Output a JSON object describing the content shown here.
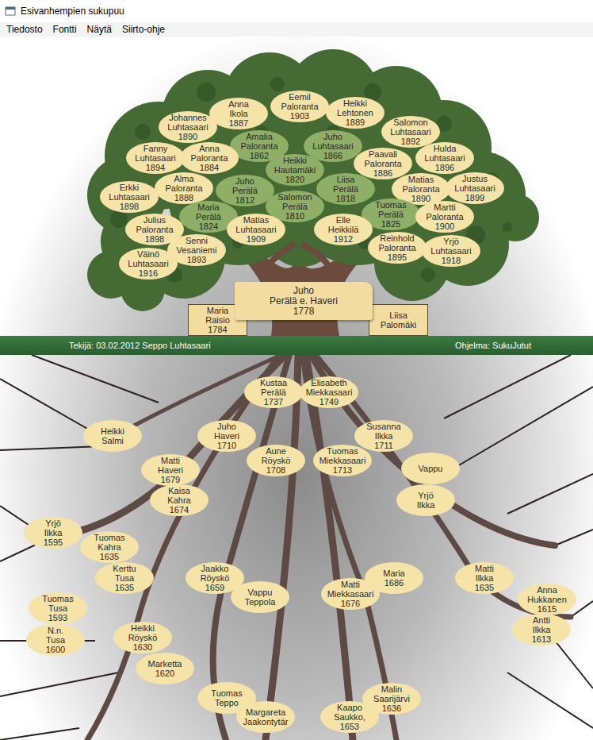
{
  "window": {
    "title": "Esivanhempien sukupuu"
  },
  "menu": [
    "Tiedosto",
    "Fontti",
    "Näytä",
    "Siirto-ohje"
  ],
  "descendants": [
    {
      "lines": [
        "Anna",
        "Ikola",
        "1887"
      ],
      "color": "#f6e3a8"
    },
    {
      "lines": [
        "Eemil",
        "Paloranta",
        "1903"
      ],
      "color": "#f6e3a8"
    },
    {
      "lines": [
        "Heikki",
        "Lehtonen",
        "1889"
      ],
      "color": "#f6e3a8"
    },
    {
      "lines": [
        "Johannes",
        "Luhtasaari",
        "1890"
      ],
      "color": "#f6e3a8"
    },
    {
      "lines": [
        "Salomon",
        "Luhtasaari",
        "1892"
      ],
      "color": "#f6e3a8"
    },
    {
      "lines": [
        "Amalia",
        "Paloranta",
        "1862"
      ],
      "color": "#8fae66"
    },
    {
      "lines": [
        "Juho",
        "Luhtasaari",
        "1866"
      ],
      "color": "#8fae66"
    },
    {
      "lines": [
        "Fanny",
        "Luhtasaari",
        "1894"
      ],
      "color": "#f6e3a8"
    },
    {
      "lines": [
        "Anna",
        "Paloranta",
        "1884"
      ],
      "color": "#f6e3a8"
    },
    {
      "lines": [
        "Hulda",
        "Luhtasaari",
        "1896"
      ],
      "color": "#f6e3a8"
    },
    {
      "lines": [
        "Paavali",
        "Paloranta",
        "1886"
      ],
      "color": "#f6e3a8"
    },
    {
      "lines": [
        "Heikki",
        "Hautamäki",
        "1820"
      ],
      "color": "#8fae66"
    },
    {
      "lines": [
        "Erkki",
        "Luhtasaari",
        "1898"
      ],
      "color": "#f6e3a8"
    },
    {
      "lines": [
        "Alma",
        "Paloranta",
        "1888"
      ],
      "color": "#f6e3a8"
    },
    {
      "lines": [
        "Juho",
        "Perälä",
        "1812"
      ],
      "color": "#8fae66"
    },
    {
      "lines": [
        "Liisa",
        "Perälä",
        "1818"
      ],
      "color": "#8fae66"
    },
    {
      "lines": [
        "Matias",
        "Paloranta",
        "1890"
      ],
      "color": "#f6e3a8"
    },
    {
      "lines": [
        "Justus",
        "Luhtasaari",
        "1899"
      ],
      "color": "#f6e3a8"
    },
    {
      "lines": [
        "Salomon",
        "Perälä",
        "1810"
      ],
      "color": "#8fae66"
    },
    {
      "lines": [
        "Maria",
        "Perälä",
        "1824"
      ],
      "color": "#8fae66"
    },
    {
      "lines": [
        "Tuomas",
        "Perälä",
        "1825"
      ],
      "color": "#8fae66"
    },
    {
      "lines": [
        "Martti",
        "Paloranta",
        "1900"
      ],
      "color": "#f6e3a8"
    },
    {
      "lines": [
        "Julius",
        "Paloranta",
        "1898"
      ],
      "color": "#f6e3a8"
    },
    {
      "lines": [
        "Matias",
        "Luhtasaari",
        "1909"
      ],
      "color": "#f6e3a8"
    },
    {
      "lines": [
        "Elle",
        "Heikkilä",
        "1912"
      ],
      "color": "#f6e3a8"
    },
    {
      "lines": [
        "Senni",
        "Vesaniemi",
        "1893"
      ],
      "color": "#f6e3a8"
    },
    {
      "lines": [
        "Reinhold",
        "Paloranta",
        "1895"
      ],
      "color": "#f6e3a8"
    },
    {
      "lines": [
        "Yrjö",
        "Luhtasaari",
        "1918"
      ],
      "color": "#f6e3a8"
    },
    {
      "lines": [
        "Väinö",
        "Luhtasaari",
        "1916"
      ],
      "color": "#f6e3a8"
    }
  ],
  "person": {
    "lines": [
      "Juho",
      "Perälä e. Haveri",
      "1778"
    ]
  },
  "spouses": [
    {
      "lines": [
        "Maria",
        "Raisio",
        "1784"
      ]
    },
    {
      "lines": [
        "Liisa",
        "Palomäki"
      ]
    }
  ],
  "footer": {
    "author": "Tekijä: 03.02.2012 Seppo Luhtasaari",
    "program": "Ohjelma: SukuJutut"
  },
  "ancestors": [
    {
      "lines": [
        "Kustaa",
        "Perälä",
        "1737"
      ]
    },
    {
      "lines": [
        "Elisabeth",
        "Miekkasaari",
        "1749"
      ]
    },
    {
      "lines": [
        "Heikki",
        "Salmi"
      ]
    },
    {
      "lines": [
        "Juho",
        "Haveri",
        "1710"
      ]
    },
    {
      "lines": [
        "Susanna",
        "Ilkka",
        "1711"
      ]
    },
    {
      "lines": [
        "Aune",
        "Röyskö",
        "1708"
      ]
    },
    {
      "lines": [
        "Tuomas",
        "Miekkasaari",
        "1713"
      ]
    },
    {
      "lines": [
        "Matti",
        "Haveri",
        "1679"
      ]
    },
    {
      "lines": [
        "Vappu"
      ]
    },
    {
      "lines": [
        "Kaisa",
        "Kahra",
        "1674"
      ]
    },
    {
      "lines": [
        "Yrjö",
        "Ilkka"
      ]
    },
    {
      "lines": [
        "Yrjö",
        "Ilkka",
        "1595"
      ]
    },
    {
      "lines": [
        "Tuomas",
        "Kahra",
        "1635"
      ]
    },
    {
      "lines": [
        "Jaakko",
        "Röyskö",
        "1659"
      ]
    },
    {
      "lines": [
        "Kerttu",
        "Tusa",
        "1635"
      ]
    },
    {
      "lines": [
        "Maria",
        "1686"
      ]
    },
    {
      "lines": [
        "Matti",
        "Miekkasaari",
        "1676"
      ]
    },
    {
      "lines": [
        "Matti",
        "Ilkka",
        "1635"
      ]
    },
    {
      "lines": [
        "Vappu",
        "Teppola"
      ]
    },
    {
      "lines": [
        "Anna",
        "Hukkanen",
        "1615"
      ]
    },
    {
      "lines": [
        "Tuomas",
        "Tusa",
        "1593"
      ]
    },
    {
      "lines": [
        "Antti",
        "Ilkka",
        "1613"
      ]
    },
    {
      "lines": [
        "N.n.",
        "Tusa",
        "1600"
      ]
    },
    {
      "lines": [
        "Heikki",
        "Röyskö",
        "1630"
      ]
    },
    {
      "lines": [
        "Marketta",
        "1620"
      ]
    },
    {
      "lines": [
        "Tuomas",
        "Teppo"
      ]
    },
    {
      "lines": [
        "Malin",
        "Saarijärvi",
        "1636"
      ]
    },
    {
      "lines": [
        "Margareta",
        "Jaakontytär"
      ]
    },
    {
      "lines": [
        "Kaapo",
        "Saukko,",
        "1653"
      ]
    }
  ]
}
